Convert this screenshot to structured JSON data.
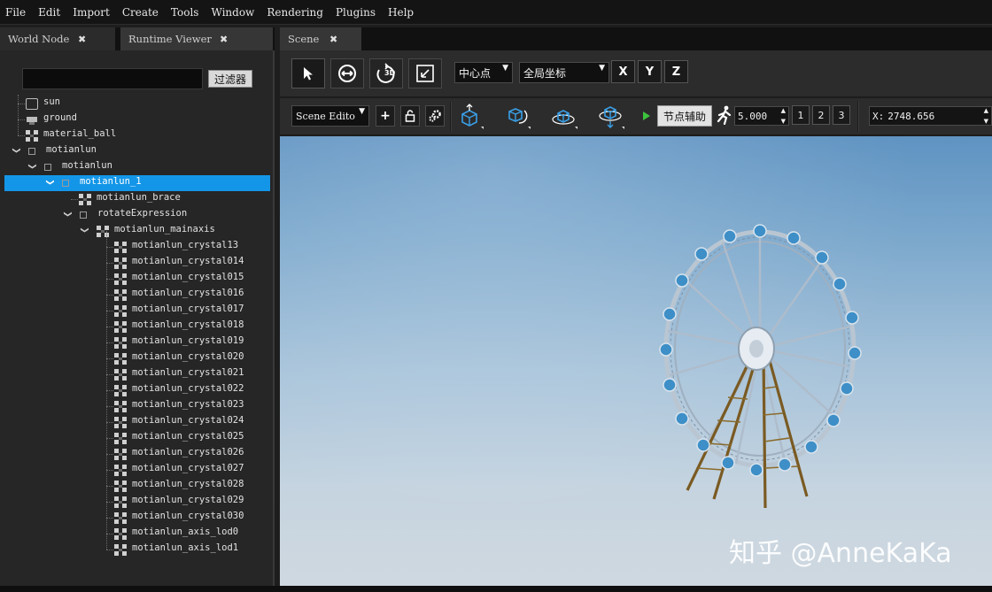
{
  "menu": [
    "File",
    "Edit",
    "Import",
    "Create",
    "Tools",
    "Window",
    "Rendering",
    "Plugins",
    "Help"
  ],
  "left_tabs": {
    "world": "World Node",
    "runtime": "Runtime Viewer",
    "close": "✖"
  },
  "filter": {
    "value": "",
    "button": "过滤器"
  },
  "tree": [
    {
      "label": "sun",
      "icon": "sun-light-icon",
      "depth": 2
    },
    {
      "label": "ground",
      "icon": "terrain-icon",
      "depth": 2
    },
    {
      "label": "material_ball",
      "icon": "mesh-icon",
      "depth": 2
    },
    {
      "label": "motianlun",
      "icon": "node-icon",
      "depth": 1,
      "expanded": true
    },
    {
      "label": "motianlun",
      "icon": "node-icon",
      "depth": 2,
      "expanded": true
    },
    {
      "label": "motianlun_1",
      "icon": "node-icon",
      "depth": 3,
      "expanded": true,
      "selected": true
    },
    {
      "label": "motianlun_brace",
      "icon": "mesh-icon",
      "depth": 5
    },
    {
      "label": "rotateExpression",
      "icon": "node-icon",
      "depth": 4,
      "expanded": true
    },
    {
      "label": "motianlun_mainaxis",
      "icon": "mesh-icon",
      "depth": 5,
      "expanded": true
    },
    {
      "label": "motianlun_crystal13",
      "icon": "mesh-icon",
      "depth": 7
    },
    {
      "label": "motianlun_crystal014",
      "icon": "mesh-icon",
      "depth": 7
    },
    {
      "label": "motianlun_crystal015",
      "icon": "mesh-icon",
      "depth": 7
    },
    {
      "label": "motianlun_crystal016",
      "icon": "mesh-icon",
      "depth": 7
    },
    {
      "label": "motianlun_crystal017",
      "icon": "mesh-icon",
      "depth": 7
    },
    {
      "label": "motianlun_crystal018",
      "icon": "mesh-icon",
      "depth": 7
    },
    {
      "label": "motianlun_crystal019",
      "icon": "mesh-icon",
      "depth": 7
    },
    {
      "label": "motianlun_crystal020",
      "icon": "mesh-icon",
      "depth": 7
    },
    {
      "label": "motianlun_crystal021",
      "icon": "mesh-icon",
      "depth": 7
    },
    {
      "label": "motianlun_crystal022",
      "icon": "mesh-icon",
      "depth": 7
    },
    {
      "label": "motianlun_crystal023",
      "icon": "mesh-icon",
      "depth": 7
    },
    {
      "label": "motianlun_crystal024",
      "icon": "mesh-icon",
      "depth": 7
    },
    {
      "label": "motianlun_crystal025",
      "icon": "mesh-icon",
      "depth": 7
    },
    {
      "label": "motianlun_crystal026",
      "icon": "mesh-icon",
      "depth": 7
    },
    {
      "label": "motianlun_crystal027",
      "icon": "mesh-icon",
      "depth": 7
    },
    {
      "label": "motianlun_crystal028",
      "icon": "mesh-icon",
      "depth": 7
    },
    {
      "label": "motianlun_crystal029",
      "icon": "mesh-icon",
      "depth": 7
    },
    {
      "label": "motianlun_crystal030",
      "icon": "mesh-icon",
      "depth": 7
    },
    {
      "label": "motianlun_axis_lod0",
      "icon": "mesh-icon",
      "depth": 7
    },
    {
      "label": "motianlun_axis_lod1",
      "icon": "mesh-icon",
      "depth": 7
    }
  ],
  "scene_tab": {
    "label": "Scene",
    "close": "✖"
  },
  "toolbar": {
    "pivot_select": "中心点",
    "coord_select": "全局坐标",
    "axes": [
      "X",
      "Y",
      "Z"
    ],
    "mode_select": "Scene Edito",
    "node_helper_button": "节点辅助",
    "speed_value": "5.000",
    "presets": [
      "1",
      "2",
      "3"
    ],
    "x_label": "X:",
    "x_value": "2748.656"
  },
  "colors": {
    "selection": "#1496e8",
    "accent_green": "#3cc43c"
  },
  "watermark": "知乎 @AnneKaKa"
}
